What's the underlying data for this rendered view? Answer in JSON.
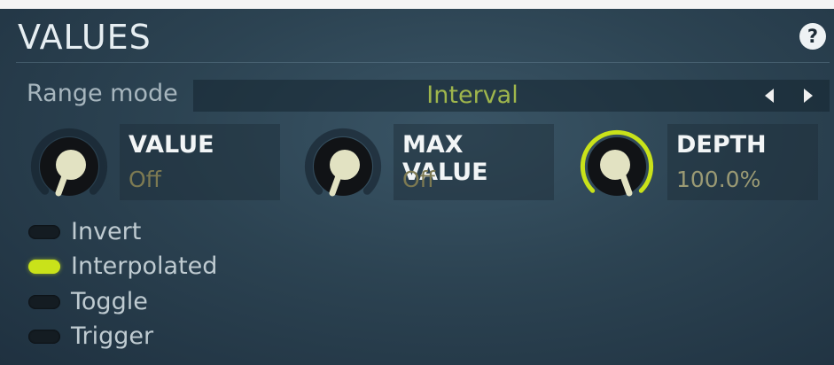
{
  "section": {
    "title": "VALUES",
    "help_label": "?"
  },
  "range_mode": {
    "label": "Range mode",
    "value": "Interval"
  },
  "knobs": [
    {
      "title": "VALUE",
      "value": "Off",
      "active": false
    },
    {
      "title": "MAX VALUE",
      "value": "Off",
      "active": false
    },
    {
      "title": "DEPTH",
      "value": "100.0%",
      "active": true
    }
  ],
  "toggles": [
    {
      "label": "Invert",
      "on": false
    },
    {
      "label": "Interpolated",
      "on": true
    },
    {
      "label": "Toggle",
      "on": false
    },
    {
      "label": "Trigger",
      "on": false
    }
  ],
  "colors": {
    "accent": "#c9e21a",
    "range_value": "#9fb64c",
    "knob_value": "#7d7a52",
    "panel_bg": "#2c4352"
  },
  "icons": {
    "help": "question-circle-icon",
    "prev": "triangle-left-icon",
    "next": "triangle-right-icon"
  }
}
